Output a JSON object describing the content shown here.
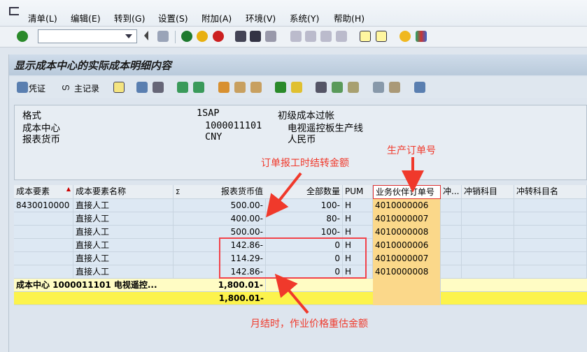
{
  "menu": [
    "清单(L)",
    "编辑(E)",
    "转到(G)",
    "设置(S)",
    "附加(A)",
    "环境(V)",
    "系统(Y)",
    "帮助(H)"
  ],
  "command_field": {
    "value": ""
  },
  "title": "显示成本中心的实际成本明细内容",
  "app_toolbar": {
    "voucher": "凭证",
    "master_record": "主记录"
  },
  "header": [
    {
      "label": "格式",
      "code": "1SAP",
      "text": "初级成本过帐"
    },
    {
      "label": "成本中心",
      "code": "1000011101",
      "text": "电视遥控板生产线"
    },
    {
      "label": "报表货币",
      "code": "CNY",
      "text": "人民币"
    }
  ],
  "columns": [
    "成本要素",
    "成本要素名称",
    "Σ",
    "报表货币值",
    "全部数量",
    "PUM",
    "业务伙伴订单号",
    "冲...",
    "冲销科目",
    "冲转科目名"
  ],
  "rows": [
    {
      "element": "8430010000",
      "name": "直接人工",
      "value": "500.00-",
      "qty": "100-",
      "pum": "H",
      "order": "4010000006"
    },
    {
      "element": "",
      "name": "直接人工",
      "value": "400.00-",
      "qty": "80-",
      "pum": "H",
      "order": "4010000007"
    },
    {
      "element": "",
      "name": "直接人工",
      "value": "500.00-",
      "qty": "100-",
      "pum": "H",
      "order": "4010000008"
    },
    {
      "element": "",
      "name": "直接人工",
      "value": "142.86-",
      "qty": "0",
      "pum": "H",
      "order": "4010000006"
    },
    {
      "element": "",
      "name": "直接人工",
      "value": "114.29-",
      "qty": "0",
      "pum": "H",
      "order": "4010000007"
    },
    {
      "element": "",
      "name": "直接人工",
      "value": "142.86-",
      "qty": "0",
      "pum": "H",
      "order": "4010000008"
    }
  ],
  "subtotal": {
    "label": "成本中心 1000011101 电视遥控...",
    "value": "1,800.01-"
  },
  "total": {
    "value": "1,800.01-"
  },
  "annotations": {
    "order_settle": "订单报工时结转金额",
    "prod_order": "生产订单号",
    "revaluation": "月结时，作业价格重估金额"
  }
}
